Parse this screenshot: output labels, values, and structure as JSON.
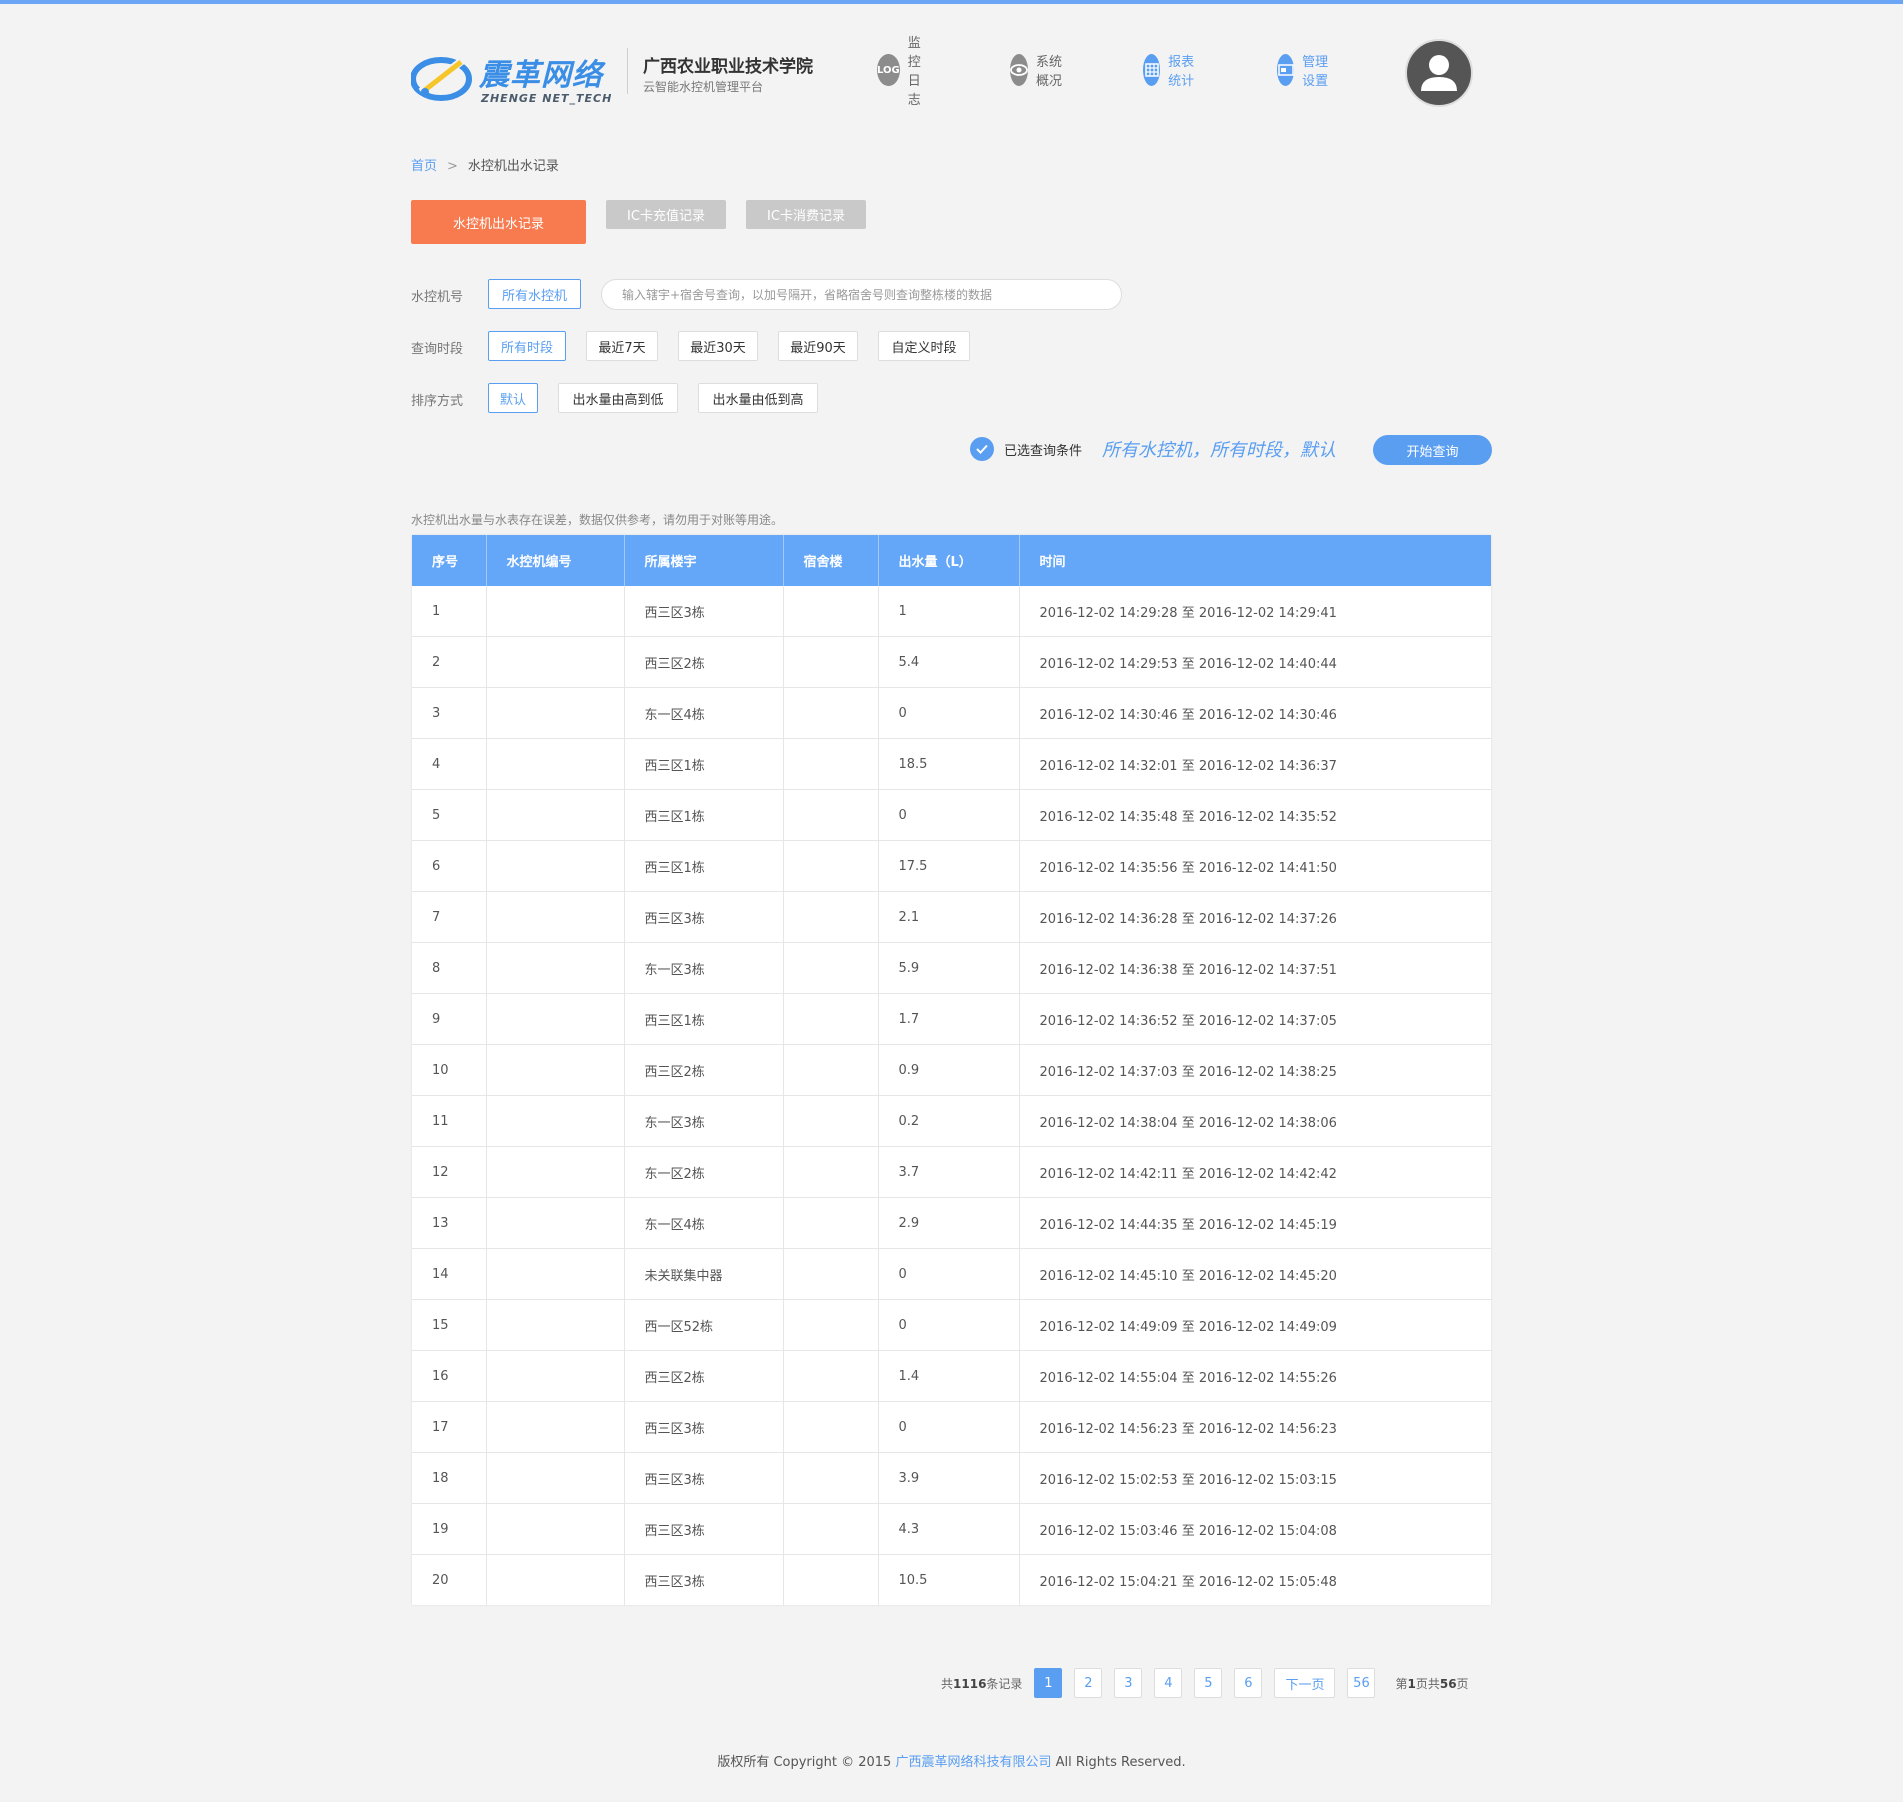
{
  "colors": {
    "accent": "#5a9ef2",
    "active_tab": "#f77b4f",
    "table_header": "#64a6f7",
    "background": "#f3f3f3"
  },
  "header": {
    "logo_cn": "震革网络",
    "logo_en": "ZHENGE NET_TECH",
    "school": "广西农业职业技术学院",
    "subtitle": "云智能水控机管理平台",
    "nav": [
      {
        "label": "监控日志",
        "icon": "log-icon"
      },
      {
        "label": "系统概况",
        "icon": "eye-icon"
      },
      {
        "label": "报表统计",
        "icon": "grid-icon"
      },
      {
        "label": "管理设置",
        "icon": "card-icon"
      }
    ],
    "log_badge": "LOG"
  },
  "breadcrumb": {
    "home": "首页",
    "sep": ">",
    "current": "水控机出水记录"
  },
  "tabs": [
    "水控机出水记录",
    "IC卡充值记录",
    "IC卡消费记录"
  ],
  "filters": {
    "machine_label": "水控机号",
    "machine_option": "所有水控机",
    "search_placeholder": "输入辖宇+宿舍号查询，以加号隔开，省略宿舍号则查询整栋楼的数据",
    "period_label": "查询时段",
    "periods": [
      "所有时段",
      "最近7天",
      "最近30天",
      "最近90天",
      "自定义时段"
    ],
    "sort_label": "排序方式",
    "sorts": [
      "默认",
      "出水量由高到低",
      "出水量由低到高"
    ],
    "selected_label": "已选查询条件",
    "selected_value": "所有水控机，所有时段，默认",
    "query_button": "开始查询"
  },
  "note": "水控机出水量与水表存在误差，数据仅供参考，请勿用于对账等用途。",
  "table": {
    "columns": [
      "序号",
      "水控机编号",
      "所属楼宇",
      "宿舍楼",
      "出水量（L）",
      "时间"
    ],
    "rows": [
      [
        "1",
        "",
        "西三区3栋",
        "",
        "1",
        "2016-12-02 14:29:28 至 2016-12-02 14:29:41"
      ],
      [
        "2",
        "",
        "西三区2栋",
        "",
        "5.4",
        "2016-12-02 14:29:53 至 2016-12-02 14:40:44"
      ],
      [
        "3",
        "",
        "东一区4栋",
        "",
        "0",
        "2016-12-02 14:30:46 至 2016-12-02 14:30:46"
      ],
      [
        "4",
        "",
        "西三区1栋",
        "",
        "18.5",
        "2016-12-02 14:32:01 至 2016-12-02 14:36:37"
      ],
      [
        "5",
        "",
        "西三区1栋",
        "",
        "0",
        "2016-12-02 14:35:48 至 2016-12-02 14:35:52"
      ],
      [
        "6",
        "",
        "西三区1栋",
        "",
        "17.5",
        "2016-12-02 14:35:56 至 2016-12-02 14:41:50"
      ],
      [
        "7",
        "",
        "西三区3栋",
        "",
        "2.1",
        "2016-12-02 14:36:28 至 2016-12-02 14:37:26"
      ],
      [
        "8",
        "",
        "东一区3栋",
        "",
        "5.9",
        "2016-12-02 14:36:38 至 2016-12-02 14:37:51"
      ],
      [
        "9",
        "",
        "西三区1栋",
        "",
        "1.7",
        "2016-12-02 14:36:52 至 2016-12-02 14:37:05"
      ],
      [
        "10",
        "",
        "西三区2栋",
        "",
        "0.9",
        "2016-12-02 14:37:03 至 2016-12-02 14:38:25"
      ],
      [
        "11",
        "",
        "东一区3栋",
        "",
        "0.2",
        "2016-12-02 14:38:04 至 2016-12-02 14:38:06"
      ],
      [
        "12",
        "",
        "东一区2栋",
        "",
        "3.7",
        "2016-12-02 14:42:11 至 2016-12-02 14:42:42"
      ],
      [
        "13",
        "",
        "东一区4栋",
        "",
        "2.9",
        "2016-12-02 14:44:35 至 2016-12-02 14:45:19"
      ],
      [
        "14",
        "",
        "未关联集中器",
        "",
        "0",
        "2016-12-02 14:45:10 至 2016-12-02 14:45:20"
      ],
      [
        "15",
        "",
        "西一区52栋",
        "",
        "0",
        "2016-12-02 14:49:09 至 2016-12-02 14:49:09"
      ],
      [
        "16",
        "",
        "西三区2栋",
        "",
        "1.4",
        "2016-12-02 14:55:04 至 2016-12-02 14:55:26"
      ],
      [
        "17",
        "",
        "西三区3栋",
        "",
        "0",
        "2016-12-02 14:56:23 至 2016-12-02 14:56:23"
      ],
      [
        "18",
        "",
        "西三区3栋",
        "",
        "3.9",
        "2016-12-02 15:02:53 至 2016-12-02 15:03:15"
      ],
      [
        "19",
        "",
        "西三区3栋",
        "",
        "4.3",
        "2016-12-02 15:03:46 至 2016-12-02 15:04:08"
      ],
      [
        "20",
        "",
        "西三区3栋",
        "",
        "10.5",
        "2016-12-02 15:04:21 至 2016-12-02 15:05:48"
      ]
    ]
  },
  "pagination": {
    "total_prefix": "共",
    "total": "1116",
    "total_suffix": "条记录",
    "pages": [
      "1",
      "2",
      "3",
      "4",
      "5",
      "6"
    ],
    "next": "下一页",
    "last": "56",
    "status_prefix": "第",
    "current": "1",
    "status_mid": "页共",
    "total_pages": "56",
    "status_suffix": "页"
  },
  "footer": {
    "prefix": "版权所有 Copyright © 2015 ",
    "company": "广西震革网络科技有限公司",
    "suffix": " All Rights Reserved."
  }
}
